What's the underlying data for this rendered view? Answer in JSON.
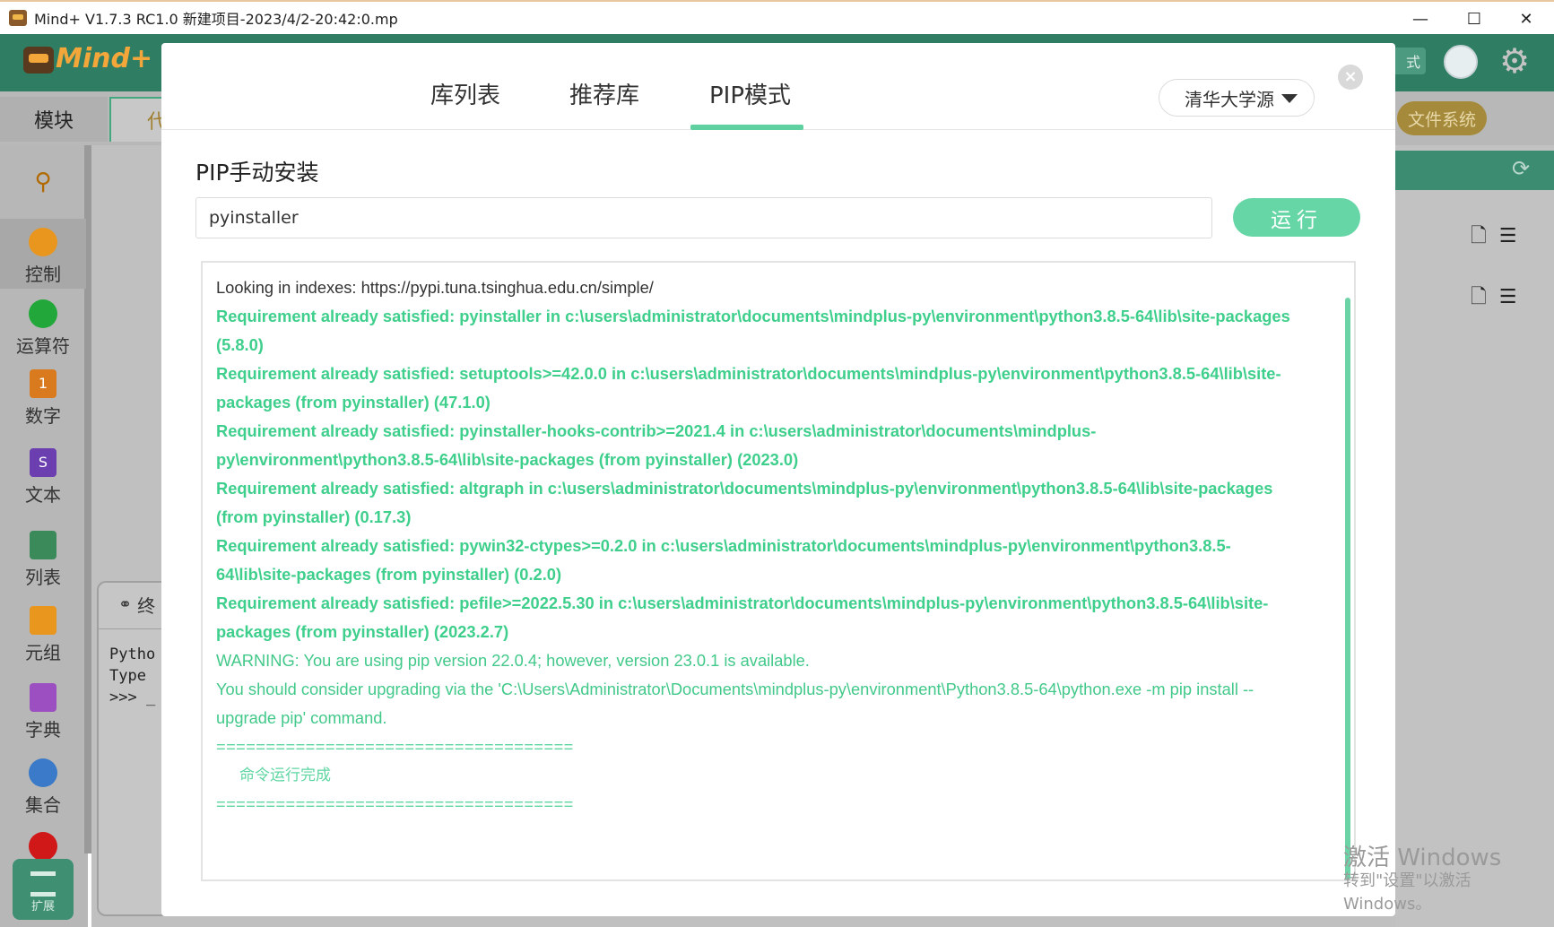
{
  "window": {
    "title": "Mind+ V1.7.3 RC1.0   新建项目-2023/4/2-20:42:0.mp",
    "minimize": "—",
    "maximize": "☐",
    "close": "✕"
  },
  "app": {
    "logo": "Mind+",
    "mode_label": "式",
    "tab_module": "模块",
    "tab_code": "代",
    "filesystem": "文件系统"
  },
  "palette": {
    "items": [
      {
        "label": "控制",
        "color": "#e8961e"
      },
      {
        "label": "运算符",
        "color": "#22a83a"
      },
      {
        "label": "数字",
        "color": "#d97a1e",
        "glyph": "1"
      },
      {
        "label": "文本",
        "color": "#6b3fb0",
        "glyph": "S"
      },
      {
        "label": "列表",
        "color": "#3a8a5a"
      },
      {
        "label": "元组",
        "color": "#e8961e"
      },
      {
        "label": "字典",
        "color": "#9b4fc0"
      },
      {
        "label": "集合",
        "color": "#3a7ac8"
      }
    ],
    "extra_dot_color": "#d01818",
    "extension": "扩展"
  },
  "console": {
    "header": "终",
    "lines": "Pytho\nType \n>>> _"
  },
  "watermark": {
    "line1": "激活 Windows",
    "line2": "转到\"设置\"以激活 Windows。"
  },
  "modal": {
    "tabs": [
      "库列表",
      "推荐库",
      "PIP模式"
    ],
    "active_tab": "PIP模式",
    "source": "清华大学源",
    "section_title": "PIP手动安装",
    "input_value": "pyinstaller",
    "run_label": "运行",
    "close": "×",
    "output": [
      {
        "kind": "plain",
        "text": "Looking in indexes: https://pypi.tuna.tsinghua.edu.cn/simple/"
      },
      {
        "kind": "ok",
        "text": "Requirement already satisfied: pyinstaller in c:\\users\\administrator\\documents\\mindplus-py\\environment\\python3.8.5-64\\lib\\site-packages"
      },
      {
        "kind": "ok",
        "text": "(5.8.0)"
      },
      {
        "kind": "ok",
        "text": "Requirement already satisfied: setuptools>=42.0.0 in c:\\users\\administrator\\documents\\mindplus-py\\environment\\python3.8.5-64\\lib\\site-"
      },
      {
        "kind": "ok",
        "text": "packages (from pyinstaller) (47.1.0)"
      },
      {
        "kind": "ok",
        "text": "Requirement already satisfied: pyinstaller-hooks-contrib>=2021.4 in c:\\users\\administrator\\documents\\mindplus-"
      },
      {
        "kind": "ok",
        "text": "py\\environment\\python3.8.5-64\\lib\\site-packages (from pyinstaller) (2023.0)"
      },
      {
        "kind": "ok",
        "text": "Requirement already satisfied: altgraph in c:\\users\\administrator\\documents\\mindplus-py\\environment\\python3.8.5-64\\lib\\site-packages"
      },
      {
        "kind": "ok",
        "text": "(from pyinstaller) (0.17.3)"
      },
      {
        "kind": "ok",
        "text": "Requirement already satisfied: pywin32-ctypes>=0.2.0 in c:\\users\\administrator\\documents\\mindplus-py\\environment\\python3.8.5-"
      },
      {
        "kind": "ok",
        "text": "64\\lib\\site-packages (from pyinstaller) (0.2.0)"
      },
      {
        "kind": "ok",
        "text": "Requirement already satisfied: pefile>=2022.5.30 in c:\\users\\administrator\\documents\\mindplus-py\\environment\\python3.8.5-64\\lib\\site-"
      },
      {
        "kind": "ok",
        "text": "packages (from pyinstaller) (2023.2.7)"
      },
      {
        "kind": "warn",
        "text": "WARNING: You are using pip version 22.0.4; however, version 23.0.1 is available."
      },
      {
        "kind": "warn",
        "text": "You should consider upgrading via the 'C:\\Users\\Administrator\\Documents\\mindplus-py\\environment\\Python3.8.5-64\\python.exe -m pip install --"
      },
      {
        "kind": "warn",
        "text": "upgrade pip' command."
      },
      {
        "kind": "sep",
        "text": " ===================================="
      },
      {
        "kind": "done",
        "text": "命令运行完成"
      },
      {
        "kind": "sep",
        "text": "===================================="
      }
    ]
  }
}
